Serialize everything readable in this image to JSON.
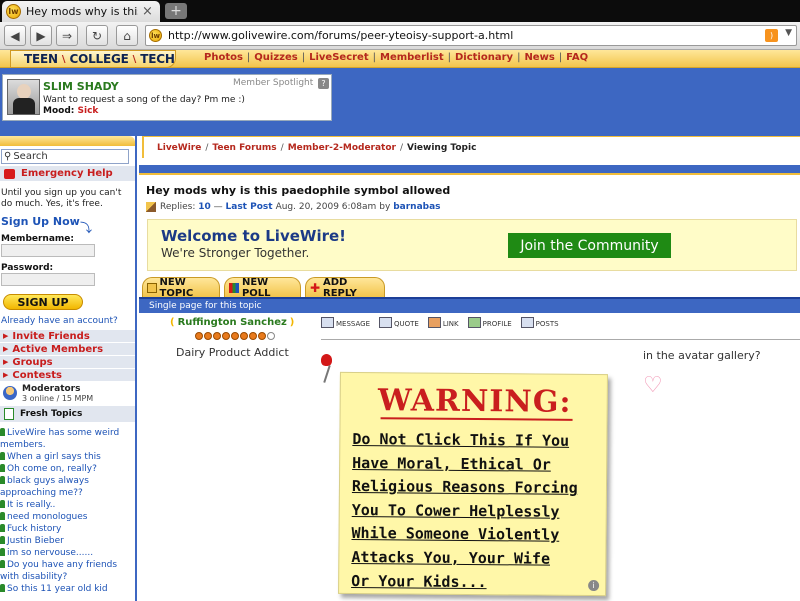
{
  "browser": {
    "tab_title": "Hey mods why is this p...",
    "tab_close": "×",
    "new_tab": "+",
    "url": "http://www.golivewire.com/forums/peer-yteoisy-support-a.html",
    "favicon_text": "lw"
  },
  "site": {
    "logo_parts": [
      "TEEN",
      "COLLEGE",
      "TECH"
    ],
    "logo_sep": "\\",
    "nav": [
      "Photos",
      "Quizzes",
      "LiveSecret",
      "Memberlist",
      "Dictionary",
      "News",
      "FAQ"
    ]
  },
  "spotlight": {
    "name": "SLIM SHADY",
    "label": "Member Spotlight",
    "help": "?",
    "message": "Want to request a song of the day? Pm me :)",
    "mood_label": "Mood:",
    "mood_value": "Sick"
  },
  "sidebar": {
    "search_placeholder": "Search",
    "emergency": "Emergency Help",
    "note": "Until you sign up you can't do much. Yes, it's free.",
    "signup_now": "Sign Up Now",
    "membername_label": "Membername:",
    "password_label": "Password:",
    "signup_button": "SIGN UP",
    "already": "Already have an account?",
    "links": [
      "Invite Friends",
      "Active Members",
      "Groups",
      "Contests"
    ],
    "moderators_title": "Moderators",
    "moderators_count": "3 online / 15 MPM",
    "fresh_title": "Fresh Topics",
    "topics": [
      "LiveWire has some weird",
      "members.",
      "When a girl says this",
      "Oh come on, really?",
      "black guys always",
      "approaching me??",
      "It is really..",
      "need monologues",
      "Fuck history",
      "Justin Bieber",
      "im so nervouse......",
      "Do you have any friends",
      "with disability?",
      "So this 11 year old kid"
    ]
  },
  "crumbs": {
    "links": [
      "LiveWire",
      "Teen Forums",
      "Member-2-Moderator"
    ],
    "current": "Viewing Topic"
  },
  "topic": {
    "title": "Hey mods why is this paedophile symbol allowed",
    "replies_label": "Replies:",
    "replies": "10",
    "dash": "—",
    "last_post_label": "Last Post",
    "last_post_date": "Aug. 20, 2009 6:08am",
    "by": "by",
    "author": "barnabas"
  },
  "welcome": {
    "title": "Welcome to LiveWire!",
    "subtitle": "We're Stronger Together.",
    "join_button": "Join the Community"
  },
  "actions": {
    "new_topic": "NEW TOPIC",
    "new_poll": "NEW POLL",
    "add_reply": "ADD REPLY",
    "single_page": "Single page for this topic"
  },
  "post": {
    "author": "Ruffington Sanchez",
    "rank": "Dairy Product Addict",
    "stars_filled": 8,
    "stars_total": 9,
    "post_actions": [
      "MESSAGE",
      "QUOTE",
      "LINK",
      "PROFILE",
      "POSTS"
    ],
    "warning_title": "WARNING:",
    "warning_lines": [
      "Do Not Click This If You",
      "Have Moral, Ethical Or",
      "Religious Reasons Forcing",
      "You To Cower Helplessly",
      "While Someone Violently",
      "Attacks You, Your Wife",
      "Or Your Kids..."
    ],
    "aside": "in the avatar gallery?",
    "heart": "♡"
  },
  "colors": {
    "accent_blue": "#3d67c2",
    "header_gold": "#f2c44c",
    "link_red": "#b5281d",
    "join_green": "#1f8a14"
  }
}
